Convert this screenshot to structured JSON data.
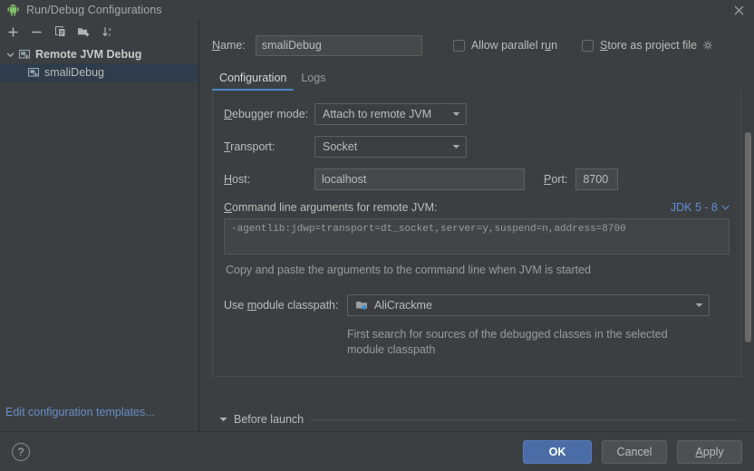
{
  "window": {
    "title": "Run/Debug Configurations",
    "app_icon": "android-robot-icon",
    "close_label": "✕"
  },
  "toolbar": {
    "add_label": "+",
    "remove_label": "−",
    "copy_label": "copy",
    "folder_label": "new-folder",
    "sort_label": "sort-alphabetically"
  },
  "tree": {
    "group": {
      "label": "Remote JVM Debug",
      "expanded": true
    },
    "child": {
      "label": "smaliDebug",
      "selected": true
    }
  },
  "sidebar": {
    "edit_templates": "Edit configuration templates..."
  },
  "header": {
    "name_label": "Name:",
    "name_mnemonic": "N",
    "name_value": "smaliDebug",
    "allow_parallel_label": "Allow parallel r",
    "allow_parallel_mnemonic": "u",
    "allow_parallel_tail": "n",
    "allow_parallel_checked": false,
    "store_project_label": "tore as project file",
    "store_project_mnemonic": "S",
    "store_project_checked": false,
    "gear_icon": "gear-icon"
  },
  "tabs": [
    {
      "label": "Configuration",
      "active": true
    },
    {
      "label": "Logs",
      "active": false
    }
  ],
  "form": {
    "debugger_mode_label_head": "",
    "debugger_mode_mnemonic": "D",
    "debugger_mode_label_tail": "ebugger mode:",
    "debugger_mode_value": "Attach to remote JVM",
    "transport_mnemonic": "T",
    "transport_label_tail": "ransport:",
    "transport_value": "Socket",
    "host_mnemonic": "H",
    "host_label_tail": "ost:",
    "host_value": "localhost",
    "port_mnemonic": "P",
    "port_label_tail": "ort:",
    "port_value": "8700",
    "cmd_mnemonic": "C",
    "cmd_label_tail": "ommand line arguments for remote JVM:",
    "jdk_selector": "JDK 5 - 8",
    "cmd_value": "-agentlib:jdwp=transport=dt_socket,server=y,suspend=n,address=8700",
    "cmd_hint": "Copy and paste the arguments to the command line when JVM is started",
    "module_label_head": "Use ",
    "module_mnemonic": "m",
    "module_label_tail": "odule classpath:",
    "module_value": "AliCrackme",
    "module_icon": "module-folder-icon",
    "module_hint": "First search for sources of the debugged classes in the selected module classpath"
  },
  "before_launch": {
    "label": "Before launch",
    "expanded": true
  },
  "footer": {
    "help_label": "?",
    "ok_label": "OK",
    "cancel_label": "Cancel",
    "apply_mnemonic": "A",
    "apply_tail": "pply"
  },
  "colors": {
    "accent_blue": "#4a88c7",
    "primary_button": "#4a6da7",
    "link_blue": "#688ec9",
    "selection": "#2e3c4b",
    "background": "#3c3f41"
  }
}
